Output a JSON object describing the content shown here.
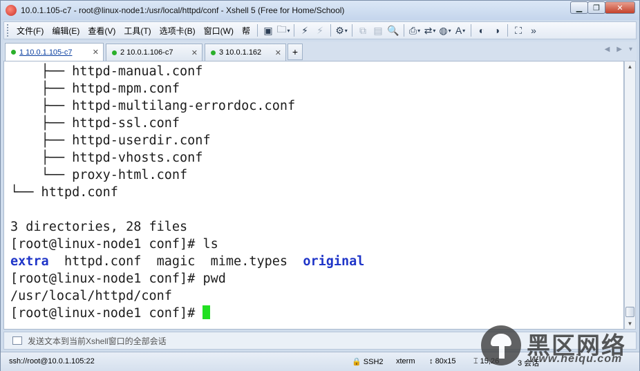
{
  "window": {
    "title": "10.0.1.105-c7 - root@linux-node1:/usr/local/httpd/conf - Xshell 5 (Free for Home/School)"
  },
  "menu": [
    "文件(F)",
    "编辑(E)",
    "查看(V)",
    "工具(T)",
    "选项卡(B)",
    "窗口(W)",
    "帮"
  ],
  "tabs": [
    {
      "label": "1 10.0.1.105-c7",
      "active": true
    },
    {
      "label": "2 10.0.1.106-c7",
      "active": false
    },
    {
      "label": "3 10.0.1.162",
      "active": false
    }
  ],
  "terminal": {
    "lines": [
      "    ├── httpd-manual.conf",
      "    ├── httpd-mpm.conf",
      "    ├── httpd-multilang-errordoc.conf",
      "    ├── httpd-ssl.conf",
      "    ├── httpd-userdir.conf",
      "    ├── httpd-vhosts.conf",
      "    └── proxy-html.conf",
      "└── httpd.conf",
      "",
      "3 directories, 28 files",
      "[root@linux-node1 conf]# ls"
    ],
    "ls_output": {
      "dir1": "extra",
      "file1": "httpd.conf",
      "file2": "magic",
      "file3": "mime.types",
      "dir2": "original"
    },
    "after_lines": [
      "[root@linux-node1 conf]# pwd",
      "/usr/local/httpd/conf",
      "[root@linux-node1 conf]# "
    ],
    "colors": {
      "directory": "#1f35c8",
      "cursor": "#22e022"
    }
  },
  "compose_bar": {
    "text": "发送文本到当前Xshell窗口的全部会话"
  },
  "status_bar": {
    "connection": "ssh://root@10.0.1.105:22",
    "protocol": "SSH2",
    "term_type": "xterm",
    "size": "80x15",
    "position": "15,26",
    "sessions": "3 会话"
  },
  "watermark": {
    "cn": "黑区网络",
    "url": "www.heiqu.com"
  }
}
